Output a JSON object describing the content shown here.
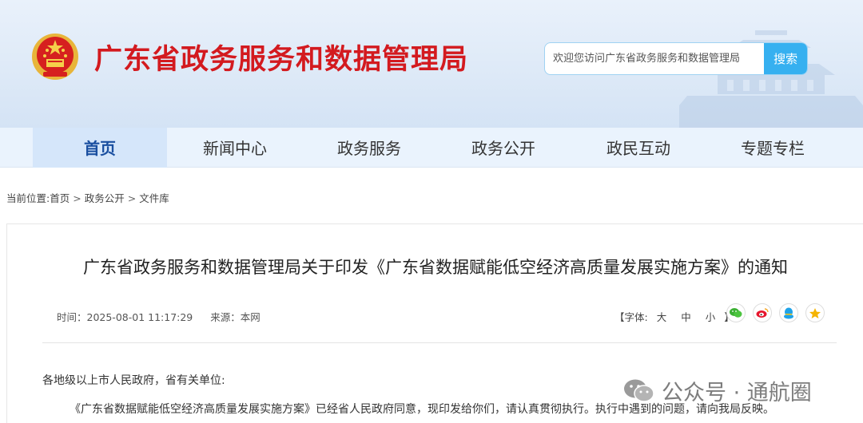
{
  "header": {
    "site_title": "广东省政务服务和数据管理局",
    "search_placeholder": "欢迎您访问广东省政务服务和数据管理局",
    "search_button": "搜索",
    "emblem_icon": "national-emblem-icon"
  },
  "nav": {
    "items": [
      {
        "label": "首页",
        "active": true
      },
      {
        "label": "新闻中心",
        "active": false
      },
      {
        "label": "政务服务",
        "active": false
      },
      {
        "label": "政务公开",
        "active": false
      },
      {
        "label": "政民互动",
        "active": false
      },
      {
        "label": "专题专栏",
        "active": false
      }
    ]
  },
  "breadcrumb": {
    "prefix": "当前位置:",
    "items": [
      "首页",
      "政务公开",
      "文件库"
    ],
    "separator": ">"
  },
  "article": {
    "title": "广东省政务服务和数据管理局关于印发《广东省数据赋能低空经济高质量发展实施方案》的通知",
    "time_label": "时间：2025-08-01 11:17:29",
    "source_label": "来源：本网",
    "font_size_prefix": "【字体:",
    "font_sizes": [
      "大",
      "中",
      "小"
    ],
    "font_size_suffix": "】",
    "share_icons": [
      "wechat-icon",
      "weibo-icon",
      "qq-icon",
      "favorite-icon"
    ],
    "paragraph1": "各地级以上市人民政府，省有关单位:",
    "paragraph2": "《广东省数据赋能低空经济高质量发展实施方案》已经省人民政府同意，现印发给你们，请认真贯彻执行。执行中遇到的问题，请向我局反映。"
  },
  "watermark": {
    "text": "公众号 · 通航圈"
  },
  "colors": {
    "title_red": "#d31a1f",
    "search_blue": "#36b0f0",
    "nav_active_bg": "#d5e6fa",
    "nav_bg": "#eaf3fd"
  }
}
